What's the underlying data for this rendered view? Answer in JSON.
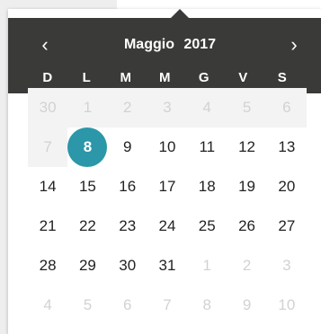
{
  "header": {
    "prev_icon": "‹",
    "next_icon": "›",
    "month": "Maggio",
    "year": "2017"
  },
  "weekdays": [
    "D",
    "L",
    "M",
    "M",
    "G",
    "V",
    "S"
  ],
  "weeks": [
    [
      {
        "d": "30",
        "muted": true,
        "shaded": true
      },
      {
        "d": "1",
        "muted": true,
        "shaded": true
      },
      {
        "d": "2",
        "muted": true,
        "shaded": true
      },
      {
        "d": "3",
        "muted": true,
        "shaded": true
      },
      {
        "d": "4",
        "muted": true,
        "shaded": true
      },
      {
        "d": "5",
        "muted": true,
        "shaded": true
      },
      {
        "d": "6",
        "muted": true,
        "shaded": true
      }
    ],
    [
      {
        "d": "7",
        "muted": true,
        "shaded": true
      },
      {
        "d": "8",
        "selected": true
      },
      {
        "d": "9"
      },
      {
        "d": "10"
      },
      {
        "d": "11"
      },
      {
        "d": "12"
      },
      {
        "d": "13"
      }
    ],
    [
      {
        "d": "14"
      },
      {
        "d": "15"
      },
      {
        "d": "16"
      },
      {
        "d": "17"
      },
      {
        "d": "18"
      },
      {
        "d": "19"
      },
      {
        "d": "20"
      }
    ],
    [
      {
        "d": "21"
      },
      {
        "d": "22"
      },
      {
        "d": "23"
      },
      {
        "d": "24"
      },
      {
        "d": "25"
      },
      {
        "d": "26"
      },
      {
        "d": "27"
      }
    ],
    [
      {
        "d": "28"
      },
      {
        "d": "29"
      },
      {
        "d": "30"
      },
      {
        "d": "31"
      },
      {
        "d": "1",
        "muted": true
      },
      {
        "d": "2",
        "muted": true
      },
      {
        "d": "3",
        "muted": true
      }
    ],
    [
      {
        "d": "4",
        "muted": true
      },
      {
        "d": "5",
        "muted": true
      },
      {
        "d": "6",
        "muted": true
      },
      {
        "d": "7",
        "muted": true
      },
      {
        "d": "8",
        "muted": true
      },
      {
        "d": "9",
        "muted": true
      },
      {
        "d": "10",
        "muted": true
      }
    ]
  ],
  "colors": {
    "header_bg": "#3a3a38",
    "selected": "#2b97a8",
    "muted_text": "#d2d2d2"
  }
}
